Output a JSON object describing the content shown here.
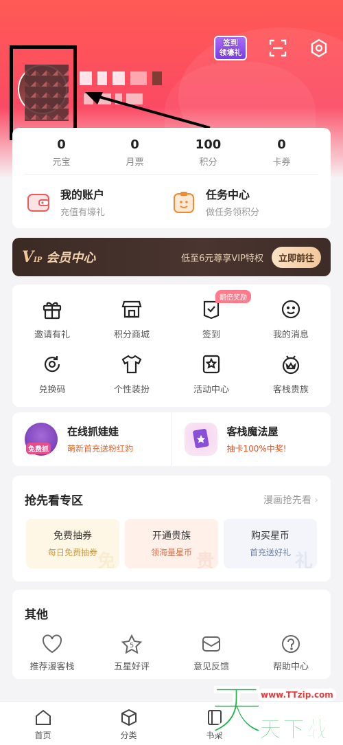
{
  "header": {
    "signin_badge_line1": "签到",
    "signin_badge_line2": "领壕礼",
    "colors": {
      "gradient_top": "#ff5a55",
      "gradient_bottom": "#fb4a63"
    }
  },
  "stats": [
    {
      "value": "0",
      "label": "元宝"
    },
    {
      "value": "0",
      "label": "月票"
    },
    {
      "value": "100",
      "label": "积分"
    },
    {
      "value": "0",
      "label": "卡券"
    }
  ],
  "quick": [
    {
      "title": "我的账户",
      "sub": "充值有壕礼",
      "icon": "wallet-icon"
    },
    {
      "title": "任务中心",
      "sub": "做任务领积分",
      "icon": "task-icon"
    }
  ],
  "vip": {
    "logo": "V",
    "logo_small": "IP",
    "title": "会员中心",
    "desc": "低至6元尊享VIP特权",
    "button": "立即前往"
  },
  "grid": [
    {
      "label": "邀请有礼",
      "icon": "gift-icon"
    },
    {
      "label": "积分商城",
      "icon": "store-icon"
    },
    {
      "label": "签到",
      "icon": "checkin-icon",
      "badge": "翻倍奖励"
    },
    {
      "label": "我的消息",
      "icon": "message-icon"
    },
    {
      "label": "兑换码",
      "icon": "redeem-icon"
    },
    {
      "label": "个性装扮",
      "icon": "tshirt-icon"
    },
    {
      "label": "活动中心",
      "icon": "activity-icon"
    },
    {
      "label": "客栈贵族",
      "icon": "crown-icon"
    }
  ],
  "promos": [
    {
      "title": "在线抓娃娃",
      "sub": "萌新首充送粉红豹",
      "tag": "免费抓"
    },
    {
      "title": "客栈魔法屋",
      "sub": "抽卡100%中奖!"
    }
  ],
  "first_look": {
    "title": "抢先看专区",
    "link": "漫画抢先看",
    "tiles": [
      {
        "title": "免费抽券",
        "sub": "每日免费抽券",
        "bg_char": "免",
        "color": "#fff7e6",
        "sub_color": "#c99a4a"
      },
      {
        "title": "开通贵族",
        "sub": "领海量星币",
        "bg_char": "贵",
        "color": "#fff0ea",
        "sub_color": "#d9724f"
      },
      {
        "title": "购买星币",
        "sub": "首充送好礼",
        "bg_char": "礼",
        "color": "#f3f5fb",
        "sub_color": "#6b7fa6"
      }
    ]
  },
  "other": {
    "title": "其他",
    "items": [
      {
        "label": "推荐漫客栈",
        "icon": "heart-icon"
      },
      {
        "label": "五星好评",
        "icon": "star-icon",
        "badge": "5"
      },
      {
        "label": "意见反馈",
        "icon": "feedback-icon"
      },
      {
        "label": "帮助中心",
        "icon": "help-icon"
      }
    ]
  },
  "tabs": [
    {
      "label": "首页",
      "icon": "home-icon"
    },
    {
      "label": "分类",
      "icon": "category-icon"
    },
    {
      "label": "书架",
      "icon": "bookshelf-icon"
    },
    {
      "label": "",
      "icon": ""
    }
  ],
  "watermark": {
    "big": "天",
    "url": "www.TTzip.com",
    "text": "天下载"
  }
}
